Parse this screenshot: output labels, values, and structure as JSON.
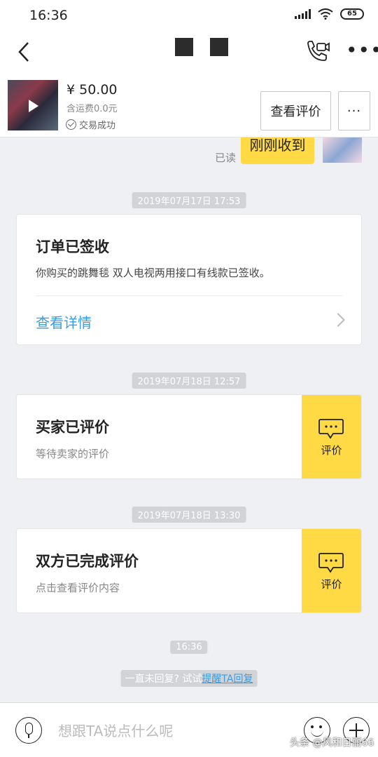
{
  "status_bar": {
    "time": "16:36",
    "battery": "65"
  },
  "header": {},
  "product": {
    "price": "¥ 50.00",
    "shipping": "含运费0.0元",
    "status": "交易成功",
    "review_button": "查看评价",
    "more_button": "···"
  },
  "messages": {
    "read_label": "已读",
    "last_bubble": "刚刚收到"
  },
  "cards": [
    {
      "timestamp": "2019年07月17日 17:53",
      "title": "订单已签收",
      "description": "你购买的跳舞毯 双人电视两用接口有线款已签收。",
      "link": "查看详情"
    },
    {
      "timestamp": "2019年07月18日 12:57",
      "title": "买家已评价",
      "subtitle": "等待卖家的评价",
      "action": "评价"
    },
    {
      "timestamp": "2019年07月18日 13:30",
      "title": "双方已完成评价",
      "subtitle": "点击查看评价内容",
      "action": "评价"
    }
  ],
  "footer_time": "16:36",
  "hint": {
    "prefix": "一直未回复? 试试",
    "link": "提醒TA回复"
  },
  "input": {
    "placeholder": "想跟TA说点什么呢"
  },
  "watermark": "头条 @风和日丽66"
}
